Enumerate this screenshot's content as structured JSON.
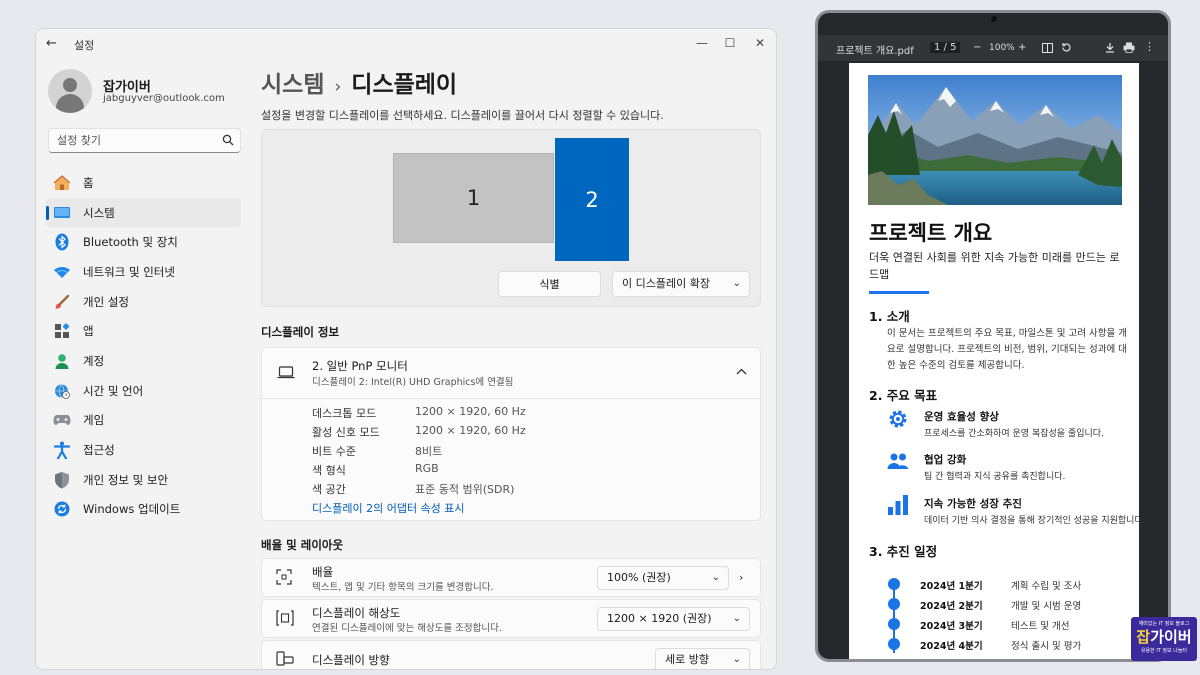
{
  "window": {
    "back_glyph": "←",
    "title": "설정",
    "minimize_glyph": "—",
    "maximize_glyph": "☐",
    "close_glyph": "✕"
  },
  "user": {
    "name": "잡가이버",
    "email": "jabguyver@outlook.com"
  },
  "search": {
    "placeholder": "설정 찾기"
  },
  "sidebar": {
    "items": [
      {
        "label": "홈",
        "icon": "home-icon"
      },
      {
        "label": "시스템",
        "icon": "system-icon",
        "active": true
      },
      {
        "label": "Bluetooth 및 장치",
        "icon": "bluetooth-icon"
      },
      {
        "label": "네트워크 및 인터넷",
        "icon": "wifi-icon"
      },
      {
        "label": "개인 설정",
        "icon": "brush-icon"
      },
      {
        "label": "앱",
        "icon": "apps-icon"
      },
      {
        "label": "계정",
        "icon": "account-icon"
      },
      {
        "label": "시간 및 언어",
        "icon": "globe-clock-icon"
      },
      {
        "label": "게임",
        "icon": "gamepad-icon"
      },
      {
        "label": "접근성",
        "icon": "accessibility-icon"
      },
      {
        "label": "개인 정보 및 보안",
        "icon": "shield-icon"
      },
      {
        "label": "Windows 업데이트",
        "icon": "update-icon"
      }
    ]
  },
  "breadcrumb": {
    "parent": "시스템",
    "separator": "›",
    "current": "디스플레이"
  },
  "arrangement": {
    "subtitle": "설정을 변경할 디스플레이를 선택하세요. 디스플레이를 끌어서 다시 정렬할 수 있습니다.",
    "monitor1": "1",
    "monitor2": "2",
    "identify_label": "식별",
    "extend_label": "이 디스플레이 확장"
  },
  "display_info": {
    "header": "디스플레이 정보",
    "monitor_title": "2. 일반 PnP 모니터",
    "monitor_subtitle": "디스플레이 2: Intel(R) UHD Graphics에 연결됨",
    "props": [
      {
        "label": "데스크톱 모드",
        "value": "1200 × 1920, 60 Hz"
      },
      {
        "label": "활성 신호 모드",
        "value": "1200 × 1920, 60 Hz"
      },
      {
        "label": "비트 수준",
        "value": "8비트"
      },
      {
        "label": "색 형식",
        "value": "RGB"
      },
      {
        "label": "색 공간",
        "value": "표준 동적 범위(SDR)"
      }
    ],
    "adapter_link": "디스플레이 2의 어댑터 속성 표시"
  },
  "scale_layout": {
    "header": "배율 및 레이아웃",
    "scale_title": "배율",
    "scale_desc": "텍스트, 앱 및 기타 항목의 크기를 변경합니다.",
    "scale_value": "100% (권장)",
    "resolution_title": "디스플레이 해상도",
    "resolution_desc": "연결된 디스플레이에 맞는 해상도를 조정합니다.",
    "resolution_value": "1200 × 1920 (권장)",
    "orientation_title": "디스플레이 방향",
    "orientation_value": "세로 방향"
  },
  "pdf": {
    "filename": "프로젝트 개요.pdf",
    "page_indicator": "1 / 5",
    "zoom_minus": "−",
    "zoom": "100%",
    "zoom_plus": "+",
    "title": "프로젝트 개요",
    "subtitle": "더욱 연결된 사회를 위한 지속 가능한 미래를 만드는 로드맵",
    "s1_title": "1.  소개",
    "s1_body": "이 문서는 프로젝트의 주요 목표, 마일스톤 및 고려 사항을 개요로 설명합니다. 프로젝트의 비전, 범위, 기대되는 성과에 대한 높은 수준의 검토를 제공합니다.",
    "s2_title": "2.  주요 목표",
    "goals": [
      {
        "title": "운영 효율성 향상",
        "desc": "프로세스를 간소화하여 운영 복잡성을 줄입니다.",
        "icon": "gear-icon"
      },
      {
        "title": "협업 강화",
        "desc": "팀 간 협력과 지식 공유를 촉진합니다.",
        "icon": "people-icon"
      },
      {
        "title": "지속 가능한 성장 추진",
        "desc": "데이터 기반 의사 결정을 통해 장기적인 성공을 지원합니다.",
        "icon": "bar-chart-icon"
      }
    ],
    "s3_title": "3.  추진 일정",
    "timeline": [
      {
        "quarter": "2024년 1분기",
        "desc": "계획 수립 및 조사"
      },
      {
        "quarter": "2024년 2분기",
        "desc": "개발 및 시범 운영"
      },
      {
        "quarter": "2024년 3분기",
        "desc": "테스트 및 개선"
      },
      {
        "quarter": "2024년 4분기",
        "desc": "정식 출시 및 평가"
      }
    ]
  },
  "logo": {
    "top": "재미있는 IT 정보 블로그",
    "brand_a": "잡",
    "brand_b": "가이버",
    "bottom": "유용한 IT 정보 나눔터"
  },
  "colors": {
    "accent": "#0067c0",
    "link": "#005fb8",
    "pdf_accent": "#1a73e8",
    "logo_bg": "#3a2a9c"
  }
}
